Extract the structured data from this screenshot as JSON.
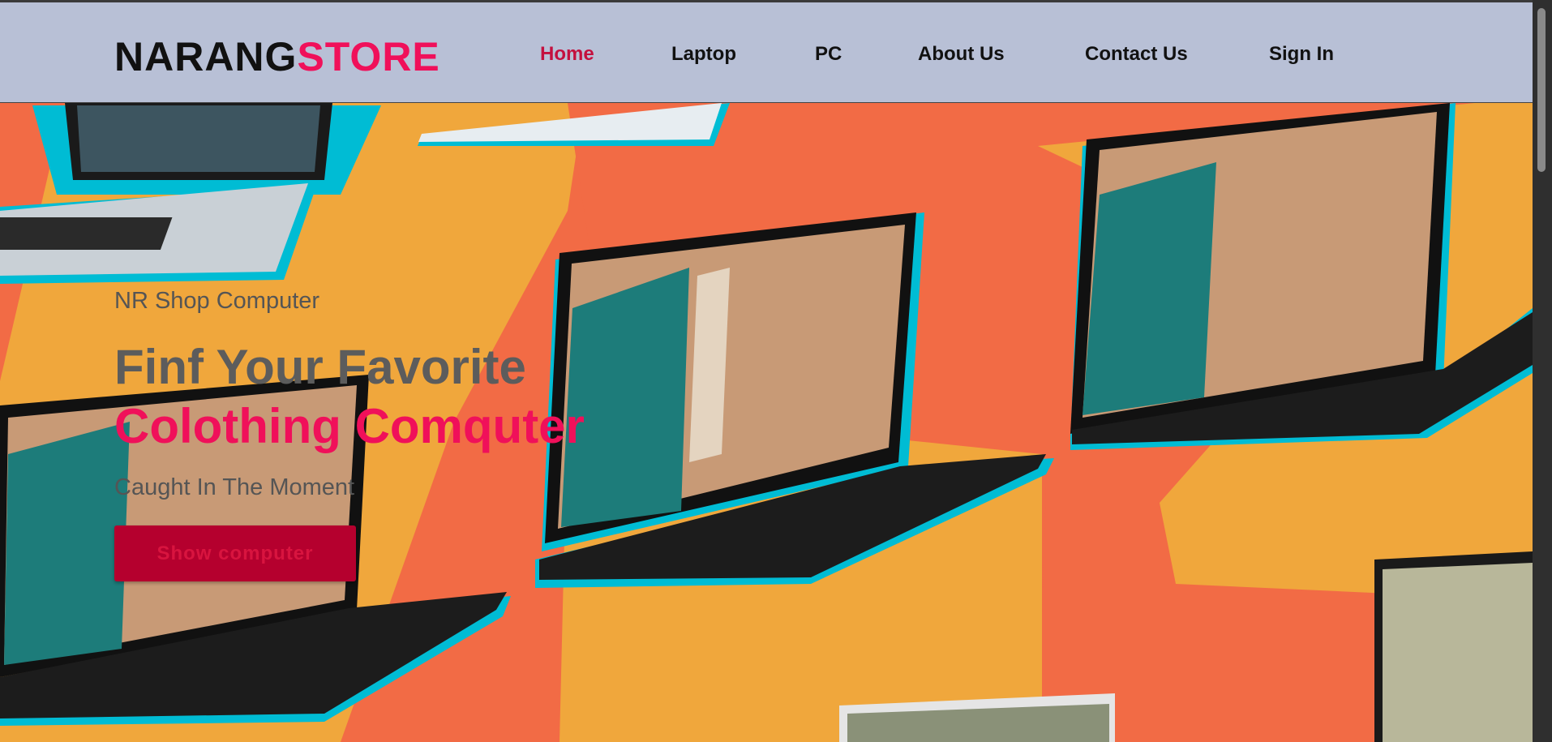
{
  "header": {
    "logo_primary": "NARANG",
    "logo_accent": "STORE"
  },
  "nav": {
    "items": [
      {
        "label": "Home",
        "active": true
      },
      {
        "label": "Laptop",
        "active": false
      },
      {
        "label": "PC",
        "active": false
      },
      {
        "label": "About Us",
        "active": false
      },
      {
        "label": "Contact Us",
        "active": false
      },
      {
        "label": "Sign In",
        "active": false
      }
    ]
  },
  "hero": {
    "subtitle": "NR Shop Computer",
    "headline_line1": "Finf Your Favorite",
    "headline_line2": "Colothing Comquter",
    "tagline": "Caught In The Moment",
    "cta_label": "Show computer"
  },
  "colors": {
    "nav_bg": "#b8c0d6",
    "accent_pink": "#f0105a",
    "active_nav": "#c4103e",
    "cta_bg": "#b5002e",
    "hero_orange": "#f26b45",
    "hero_yellow": "#f0a73c"
  }
}
